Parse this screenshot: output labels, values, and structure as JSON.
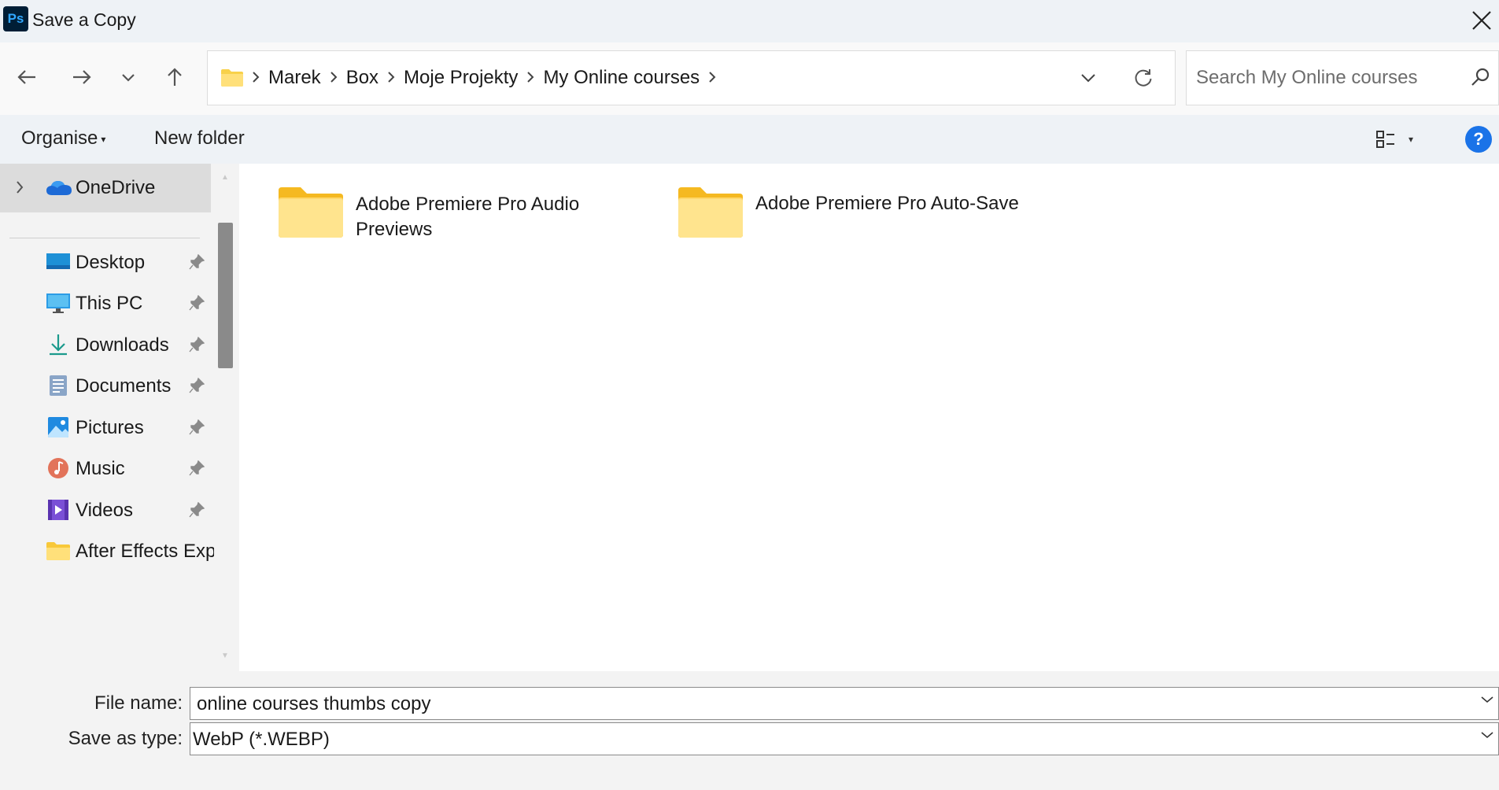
{
  "window": {
    "title": "Save a Copy",
    "app_icon_text": "Ps"
  },
  "nav": {
    "breadcrumbs": [
      "Marek",
      "Box",
      "Moje Projekty",
      "My Online courses"
    ],
    "search_placeholder": "Search My Online courses"
  },
  "toolbar": {
    "organise_label": "Organise",
    "new_folder_label": "New folder",
    "help_label": "?"
  },
  "sidebar": {
    "onedrive_label": "OneDrive",
    "items": [
      {
        "label": "Desktop",
        "icon": "desktop-icon"
      },
      {
        "label": "This PC",
        "icon": "monitor-icon"
      },
      {
        "label": "Downloads",
        "icon": "download-icon"
      },
      {
        "label": "Documents",
        "icon": "documents-icon"
      },
      {
        "label": "Pictures",
        "icon": "pictures-icon"
      },
      {
        "label": "Music",
        "icon": "music-icon"
      },
      {
        "label": "Videos",
        "icon": "videos-icon"
      },
      {
        "label": "After Effects Exp",
        "icon": "folder-icon"
      }
    ]
  },
  "folders": [
    {
      "name": "Adobe Premiere Pro Audio Previews"
    },
    {
      "name": "Adobe Premiere Pro Auto-Save"
    }
  ],
  "bottom": {
    "file_name_label": "File name:",
    "file_name_value": "online courses thumbs copy",
    "save_type_label": "Save as type:",
    "save_type_value": "WebP (*.WEBP)"
  },
  "colors": {
    "folder": "#f8d14a",
    "accent": "#1a73e8",
    "ps_bg": "#001e36",
    "ps_fg": "#31a8ff"
  }
}
